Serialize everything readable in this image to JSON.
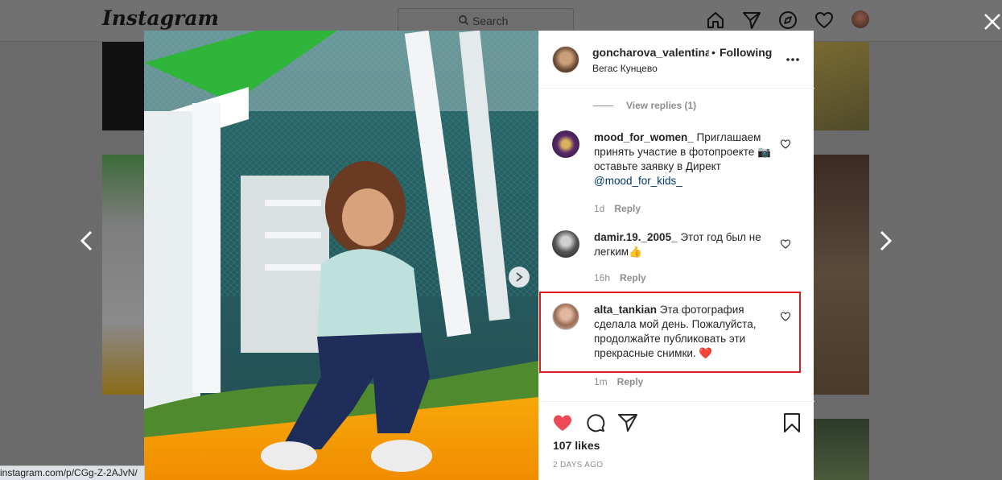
{
  "app": {
    "logo": "Instagram"
  },
  "header": {
    "search_placeholder": "Search"
  },
  "post": {
    "username": "goncharova_valentinaa",
    "follow_dot": "•",
    "follow_label": "Following",
    "location": "Вегас Кунцево"
  },
  "comments": {
    "view_replies": "View replies (1)",
    "items": [
      {
        "user": "mood_for_women_",
        "text": " Приглашаем принять участие в фотопроекте 📷оставьте заявку в Директ ",
        "mention": "@mood_for_kids_",
        "time": "1d",
        "reply": "Reply"
      },
      {
        "user": "damir.19._2005_",
        "text": " Этот год был не легким👍",
        "mention": "",
        "time": "16h",
        "reply": "Reply"
      },
      {
        "user": "alta_tankian",
        "text": " Эта фотография сделала мой день. Пожалуйста, продолжайте публиковать эти прекрасные снимки. ❤️",
        "mention": "",
        "time": "1m",
        "reply": "Reply"
      }
    ]
  },
  "actions": {
    "likes": "107 likes",
    "date": "2 DAYS AGO"
  },
  "status_bar": {
    "url": "instagram.com/p/CGg-Z-2AJvN/"
  },
  "colors": {
    "like_red": "#ed4956",
    "highlight_red": "#e11b1b",
    "overlay": "#6b6b6b"
  },
  "icons": [
    "home-icon",
    "direct-icon",
    "explore-icon",
    "heart-icon",
    "close-icon",
    "chevron-left-icon",
    "chevron-right-icon",
    "more-icon",
    "comment-icon",
    "share-icon",
    "bookmark-icon",
    "search-icon"
  ]
}
